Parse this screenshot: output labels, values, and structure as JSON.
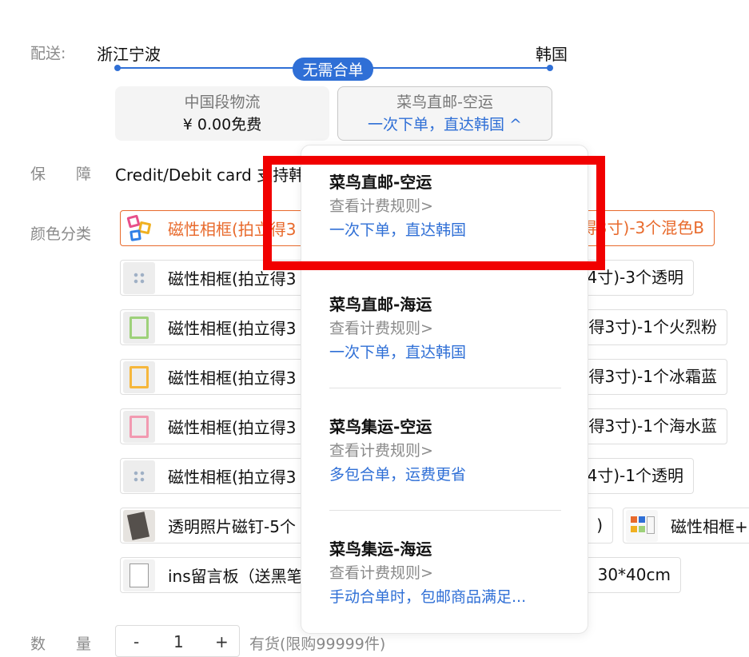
{
  "shipping": {
    "label": "配送:",
    "origin": "浙江宁波",
    "destination": "韩国",
    "badge": "无需合单",
    "options": [
      {
        "title": "中国段物流",
        "subtitle": "¥ 0.00免费"
      },
      {
        "title": "菜鸟直邮-空运",
        "subtitle": "一次下单，直达韩国 ^"
      }
    ]
  },
  "guarantee": {
    "label": "保　　障",
    "text": "Credit/Debit card 支持韩"
  },
  "color": {
    "label": "颜色分类",
    "variants": [
      {
        "left": "磁性相框(拍立得3",
        "right": "得3寸)-3个混色B"
      },
      {
        "left": "磁性相框(拍立得3",
        "right": "4寸)-3个透明"
      },
      {
        "left": "磁性相框(拍立得3",
        "right": "得3寸)-1个火烈粉"
      },
      {
        "left": "磁性相框(拍立得3",
        "right": "得3寸)-1个冰霜蓝"
      },
      {
        "left": "磁性相框(拍立得3",
        "right": "得3寸)-1个海水蓝"
      },
      {
        "left": "磁性相框(拍立得3",
        "right": "4寸)-1个透明"
      },
      {
        "left": "透明照片磁钉-5个",
        "right": ")"
      },
      {
        "left": "磁性相框+",
        "right": ""
      },
      {
        "left": "ins留言板（送黑笔",
        "right": "30*40cm"
      }
    ]
  },
  "quantity": {
    "label": "数　　量",
    "minus": "-",
    "value": "1",
    "plus": "+",
    "stock": "有货(限购99999件)"
  },
  "dropdown": {
    "options": [
      {
        "name": "菜鸟直邮-空运",
        "rule": "查看计费规则>",
        "desc": "一次下单，直达韩国"
      },
      {
        "name": "菜鸟直邮-海运",
        "rule": "查看计费规则>",
        "desc": "一次下单，直达韩国"
      },
      {
        "name": "菜鸟集运-空运",
        "rule": "查看计费规则>",
        "desc": "多包合单，运费更省"
      },
      {
        "name": "菜鸟集运-海运",
        "rule": "查看计费规则>",
        "desc": "手动合单时，包邮商品满足..."
      }
    ]
  },
  "colors": {
    "accent": "#2f6fd6",
    "selected": "#e86a2c",
    "highlight": "#f10000"
  }
}
